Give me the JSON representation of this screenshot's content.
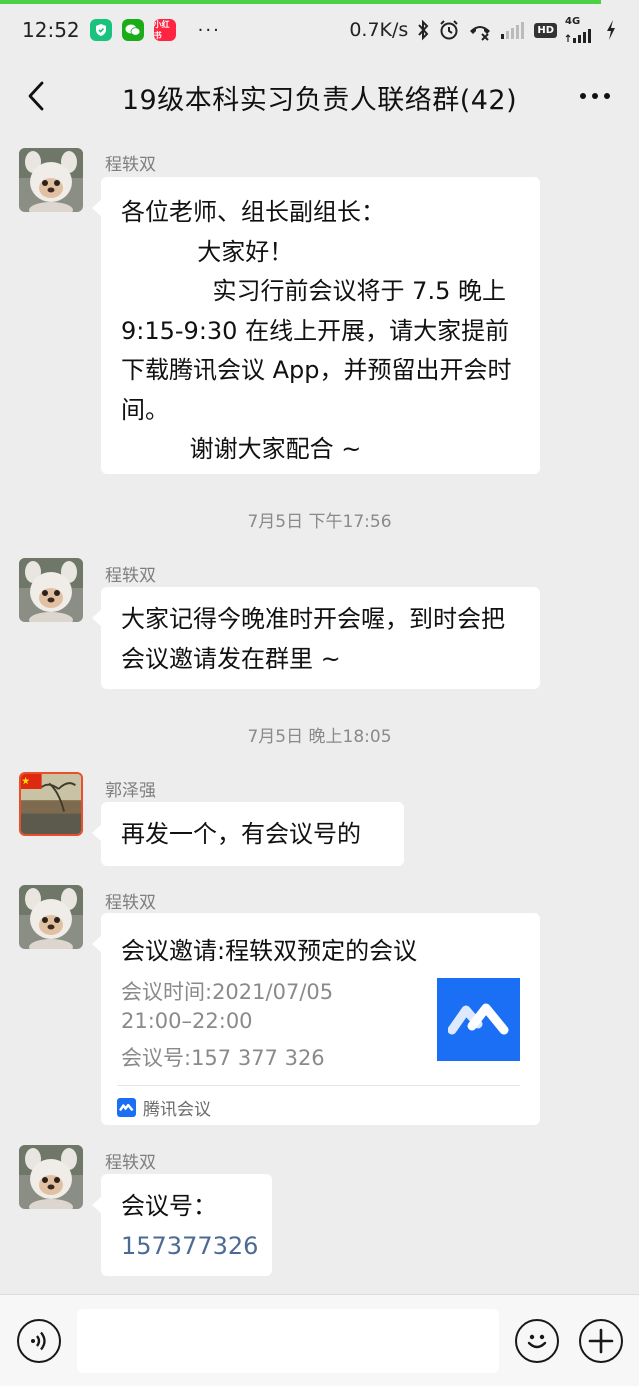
{
  "status_bar": {
    "time": "12:52",
    "apps": [
      {
        "icon": "shield-app-icon",
        "color": "#19c37d"
      },
      {
        "icon": "wechat-app-icon",
        "color": "#1aad19"
      },
      {
        "icon": "xiaohongshu-app-icon",
        "color": "#ff2442",
        "label": "小红书"
      }
    ],
    "dots": "···",
    "speed": "0.7K/s",
    "hd_label": "HD",
    "network_label": "4G",
    "download_progress": 0.94,
    "progress_color": "#4cd045"
  },
  "header": {
    "title": "19级本科实习负责人联络群(42)",
    "back_icon": "chevron-left-icon",
    "more_icon": "more-dots-icon"
  },
  "messages": [
    {
      "sender": "程轶双",
      "text": "各位老师、组长副组长：\n          大家好！\n            实习行前会议将于 7.5 晚上 9:15-9:30 在线上开展，请大家提前下载腾讯会议 App，并预留出开会时间。\n         谢谢大家配合 ~"
    },
    {
      "timestamp": "7月5日 下午17:56"
    },
    {
      "sender": "程轶双",
      "text": "大家记得今晚准时开会喔，到时会把会议邀请发在群里 ~"
    },
    {
      "timestamp": "7月5日 晚上18:05"
    },
    {
      "sender": "郭泽强",
      "text": "再发一个，有会议号的"
    },
    {
      "sender": "程轶双",
      "card": {
        "title": "会议邀请:程轶双预定的会议",
        "time_line": "会议时间:2021/07/05",
        "time_range": "21:00–22:00",
        "meeting_id_line": "会议号:157 377 326",
        "source": "腾讯会议",
        "logo_color": "#1b6ff5"
      }
    },
    {
      "sender": "程轶双",
      "label": "会议号：",
      "number": "157377326"
    }
  ],
  "input_bar": {
    "voice_icon": "voice-icon",
    "emoji_icon": "emoji-icon",
    "plus_icon": "plus-icon",
    "value": ""
  }
}
